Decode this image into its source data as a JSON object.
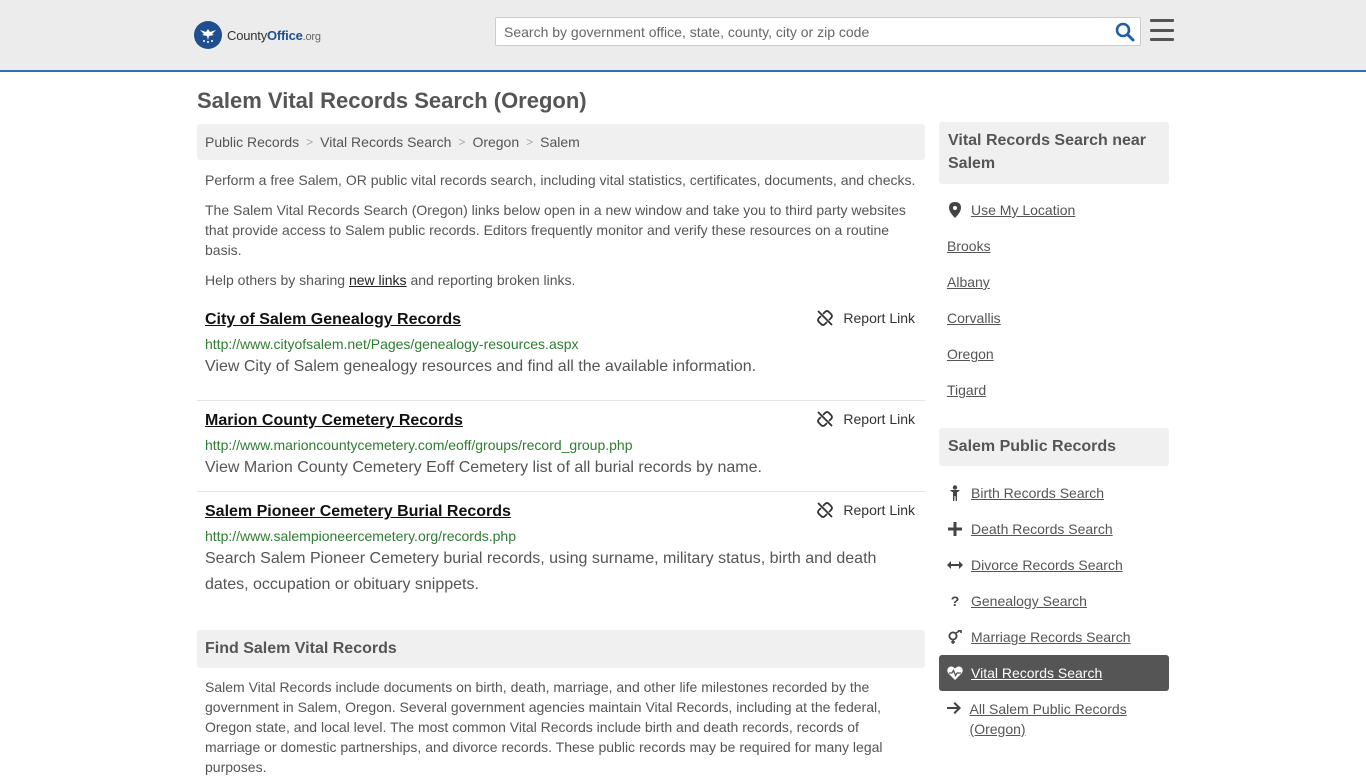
{
  "header": {
    "logo": {
      "part1": "County",
      "part2": "Office",
      "part3": ".org"
    },
    "search_placeholder": "Search by government office, state, county, city or zip code",
    "search_icon": "search-icon",
    "menu_icon": "hamburger-menu-icon"
  },
  "page_title": "Salem Vital Records Search (Oregon)",
  "breadcrumb": [
    "Public Records",
    "Vital Records Search",
    "Oregon",
    "Salem"
  ],
  "intro": {
    "p1": "Perform a free Salem, OR public vital records search, including vital statistics, certificates, documents, and checks.",
    "p2": "The Salem Vital Records Search (Oregon) links below open in a new window and take you to third party websites that provide access to Salem public records. Editors frequently monitor and verify these resources on a routine basis.",
    "p3_before": "Help others by sharing ",
    "p3_link": "new links",
    "p3_after": " and reporting broken links."
  },
  "records": [
    {
      "title": "City of Salem Genealogy Records",
      "url": "http://www.cityofsalem.net/Pages/genealogy-resources.aspx",
      "description": "View City of Salem genealogy resources and find all the available information.",
      "report_label": "Report Link"
    },
    {
      "title": "Marion County Cemetery Records",
      "url": "http://www.marioncountycemetery.com/eoff/groups/record_group.php",
      "description": "View Marion County Cemetery Eoff Cemetery list of all burial records by name.",
      "report_label": "Report Link"
    },
    {
      "title": "Salem Pioneer Cemetery Burial Records",
      "url": "http://www.salempioneercemetery.org/records.php",
      "description": "Search Salem Pioneer Cemetery burial records, using surname, military status, birth and death dates, occupation or obituary snippets.",
      "report_label": "Report Link"
    }
  ],
  "find_section": {
    "heading": "Find Salem Vital Records",
    "text": "Salem Vital Records include documents on birth, death, marriage, and other life milestones recorded by the government in Salem, Oregon. Several government agencies maintain Vital Records, including at the federal, Oregon state, and local level. The most common Vital Records include birth and death records, records of marriage or domestic partnerships, and divorce records. These public records may be required for many legal purposes."
  },
  "sidebar": {
    "near_heading": "Vital Records Search near Salem",
    "near_items": [
      "Use My Location",
      "Brooks",
      "Albany",
      "Corvallis",
      "Oregon",
      "Tigard"
    ],
    "public_heading": "Salem Public Records",
    "public_items": [
      {
        "label": "Birth Records Search",
        "icon": "child-icon"
      },
      {
        "label": "Death Records Search",
        "icon": "plus-icon"
      },
      {
        "label": "Divorce Records Search",
        "icon": "arrows-horizontal-icon"
      },
      {
        "label": "Genealogy Search",
        "icon": "question-icon"
      },
      {
        "label": "Marriage Records Search",
        "icon": "gender-icon"
      },
      {
        "label": "Vital Records Search",
        "icon": "heartbeat-icon",
        "active": true
      },
      {
        "label": "All Salem Public Records (Oregon)",
        "icon": "arrow-right-icon"
      }
    ]
  },
  "colors": {
    "header_bg": "#ececec",
    "header_border": "#2a6ebb",
    "url_green": "#2e7d32",
    "active_bg": "#555555",
    "search_icon": "#1f5fa8"
  }
}
